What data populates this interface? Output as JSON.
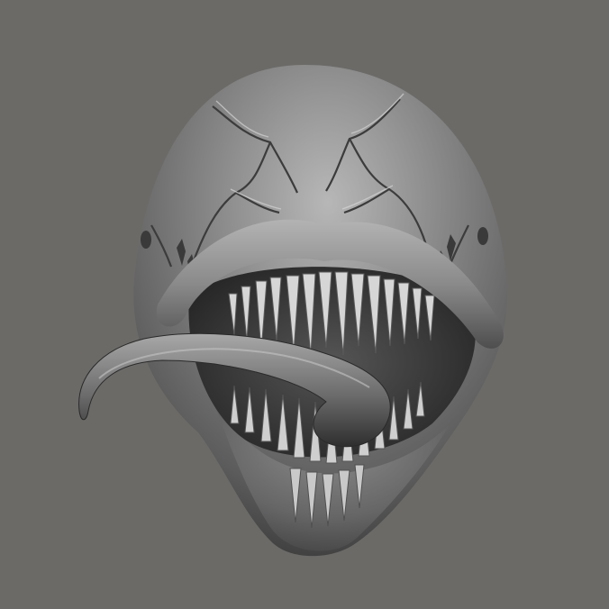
{
  "scene": {
    "subject": "sculpted-creature-head-render",
    "colors": {
      "background": "#6b6a67",
      "surface_light": "#a9a9a9",
      "surface_mid": "#7f7f7f",
      "surface_dark": "#2f2f2f",
      "teeth": "#d7d7d7"
    }
  }
}
